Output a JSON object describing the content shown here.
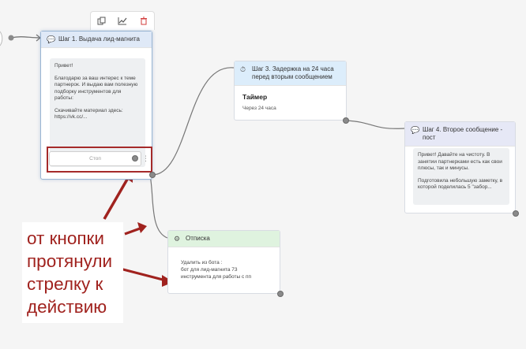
{
  "toolbar": {
    "icons": [
      "copy-icon",
      "chart-icon",
      "trash-icon"
    ]
  },
  "step1": {
    "title": "Шаг 1. Выдача лид-магнита",
    "message": [
      "Привет!",
      "Благодарю за ваш интерес к теме партнерок. И выдаю вам полезную подборку инструментов для работы:",
      "Скачивайте материал здесь:\nhttps://vk.cc/..."
    ],
    "button_label": "Стоп"
  },
  "step3": {
    "title": "Шаг 3. Задержка на 24 часа перед вторым сообщением",
    "timer_label": "Таймер",
    "timer_value": "Через 24 часа"
  },
  "step4": {
    "title": "Шаг 4. Второе сообщение - пост",
    "message": [
      "Привет! Давайте на чистоту. В занятии партнерками есть как свои плюсы, так и минусы.",
      "Подготовила небольшую заметку, в которой поделилась 5 \"забор..."
    ]
  },
  "unsubscribe": {
    "title": "Отписка",
    "text": "Удалить из бота :\nбот для лид-магнита 73\nинструмента для работы с пп"
  },
  "annotation": {
    "text": "от кнопки протянули стрелку к действию",
    "color": "#a0221e"
  }
}
